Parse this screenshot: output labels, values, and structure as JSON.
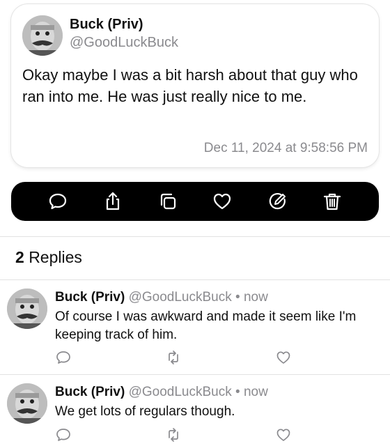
{
  "post": {
    "author_name": "Buck (Priv)",
    "author_handle": "@GoodLuckBuck",
    "text": "Okay maybe I was a bit harsh about that guy who ran into me. He was just really nice to me.",
    "timestamp": "Dec 11, 2024 at 9:58:56 PM"
  },
  "action_bar": {
    "icons": [
      "comment-icon",
      "share-icon",
      "copy-icon",
      "heart-icon",
      "edit-icon",
      "trash-icon"
    ]
  },
  "replies_header": {
    "count": "2",
    "label": "Replies"
  },
  "replies": [
    {
      "author_name": "Buck (Priv)",
      "author_handle": "@GoodLuckBuck",
      "separator": "•",
      "time": "now",
      "text": "Of course I was awkward and made it seem like I'm keeping track of him."
    },
    {
      "author_name": "Buck (Priv)",
      "author_handle": "@GoodLuckBuck",
      "separator": "•",
      "time": "now",
      "text": "We get lots of regulars though."
    }
  ],
  "colors": {
    "secondary_text": "#8a8a8e",
    "action_bar_bg": "#000000",
    "action_icon": "#ffffff",
    "reply_icon": "#8a8a8e"
  }
}
